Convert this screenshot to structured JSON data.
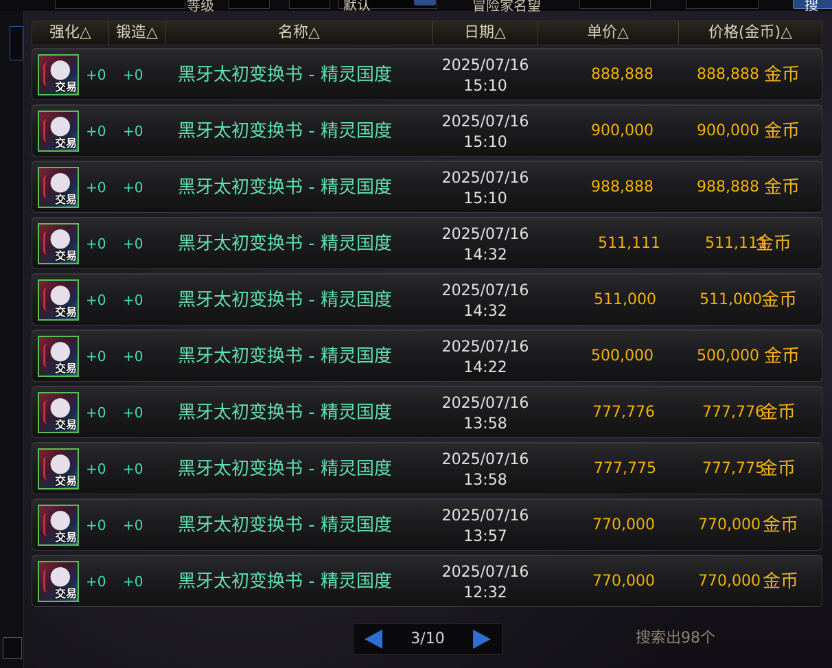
{
  "top_filter": {
    "level_label": "等级",
    "sort_value": "默认",
    "adventurer_label": "冒险家名望",
    "search_button": "搜"
  },
  "table": {
    "columns": [
      {
        "key": "enhance",
        "label": "强化△"
      },
      {
        "key": "forge",
        "label": "锻造△"
      },
      {
        "key": "name",
        "label": "名称△"
      },
      {
        "key": "date",
        "label": "日期△"
      },
      {
        "key": "unit_price",
        "label": "单价△"
      },
      {
        "key": "price",
        "label": "价格(金币)△"
      }
    ],
    "rows": [
      {
        "icon_badge": "交易",
        "enhance": "+0",
        "forge": "+0",
        "name": "黑牙太初变换书 - 精灵国度",
        "date": "2025/07/16",
        "time": "15:10",
        "unit_price": "888,888",
        "price": "888,888",
        "currency": "金币"
      },
      {
        "icon_badge": "交易",
        "enhance": "+0",
        "forge": "+0",
        "name": "黑牙太初变换书 - 精灵国度",
        "date": "2025/07/16",
        "time": "15:10",
        "unit_price": "900,000",
        "price": "900,000",
        "currency": "金币"
      },
      {
        "icon_badge": "交易",
        "enhance": "+0",
        "forge": "+0",
        "name": "黑牙太初变换书 - 精灵国度",
        "date": "2025/07/16",
        "time": "15:10",
        "unit_price": "988,888",
        "price": "988,888",
        "currency": "金币"
      },
      {
        "icon_badge": "交易",
        "enhance": "+0",
        "forge": "+0",
        "name": "黑牙太初变换书 - 精灵国度",
        "date": "2025/07/16",
        "time": "14:32",
        "unit_price": "511,111",
        "price": "511,111",
        "currency": "金币"
      },
      {
        "icon_badge": "交易",
        "enhance": "+0",
        "forge": "+0",
        "name": "黑牙太初变换书 - 精灵国度",
        "date": "2025/07/16",
        "time": "14:32",
        "unit_price": "511,000",
        "price": "511,000",
        "currency": "金币"
      },
      {
        "icon_badge": "交易",
        "enhance": "+0",
        "forge": "+0",
        "name": "黑牙太初变换书 - 精灵国度",
        "date": "2025/07/16",
        "time": "14:22",
        "unit_price": "500,000",
        "price": "500,000",
        "currency": "金币"
      },
      {
        "icon_badge": "交易",
        "enhance": "+0",
        "forge": "+0",
        "name": "黑牙太初变换书 - 精灵国度",
        "date": "2025/07/16",
        "time": "13:58",
        "unit_price": "777,776",
        "price": "777,776",
        "currency": "金币"
      },
      {
        "icon_badge": "交易",
        "enhance": "+0",
        "forge": "+0",
        "name": "黑牙太初变换书 - 精灵国度",
        "date": "2025/07/16",
        "time": "13:58",
        "unit_price": "777,775",
        "price": "777,775",
        "currency": "金币"
      },
      {
        "icon_badge": "交易",
        "enhance": "+0",
        "forge": "+0",
        "name": "黑牙太初变换书 - 精灵国度",
        "date": "2025/07/16",
        "time": "13:57",
        "unit_price": "770,000",
        "price": "770,000",
        "currency": "金币"
      },
      {
        "icon_badge": "交易",
        "enhance": "+0",
        "forge": "+0",
        "name": "黑牙太初变换书 - 精灵国度",
        "date": "2025/07/16",
        "time": "12:32",
        "unit_price": "770,000",
        "price": "770,000",
        "currency": "金币"
      }
    ]
  },
  "pagination": {
    "page_text": "3/10",
    "prev_icon": "left-triangle-icon",
    "next_icon": "right-triangle-icon"
  },
  "result_count": "搜索出98个",
  "colors": {
    "name_text": "#5fe0b2",
    "price_text": "#f1b000",
    "header_text": "#d9d2b8",
    "accent_blue": "#2f6fd0"
  }
}
